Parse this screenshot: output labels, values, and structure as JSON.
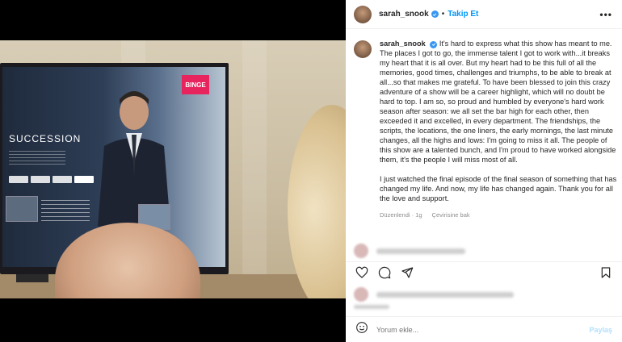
{
  "header": {
    "username": "sarah_snook",
    "separator": "•",
    "follow_label": "Takip Et",
    "more_label": "•••"
  },
  "media": {
    "tv": {
      "show_title": "SUCCESSION",
      "brand": "BINGE"
    }
  },
  "caption": {
    "username": "sarah_snook",
    "paragraph1": "It's hard to express what this show has meant to me. The places I got to go, the immense talent I got to work with...it breaks my heart that it is all over. But my heart had to be this full of all the memories, good times, challenges and triumphs, to be able to break at all...so that makes me grateful. To have been blessed to join this crazy adventure of a show will be a career highlight, which will no doubt be hard to top. I am so, so proud and humbled by everyone's hard work season after season: we all set the bar high for each other, then exceeded it and excelled, in every department. The friendships, the scripts, the locations, the one liners, the early mornings, the last minute changes, all the highs and lows: I'm going to miss it all. The people of this show are a talented bunch, and I'm proud to have worked alongside them, it's the people I will miss most of all.",
    "paragraph2": "I just watched the final episode of the final season of something that has changed my life. And now, my life has changed again. Thank you for all the love and support.",
    "edited_label": "Düzenlendi",
    "time_ago": "1g",
    "translate_label": "Çevirisine bak"
  },
  "comment_box": {
    "placeholder": "Yorum ekle...",
    "post_label": "Paylaş"
  },
  "colors": {
    "accent": "#0095f6",
    "verified": "#3897f0",
    "muted": "#8e8e8e"
  },
  "icons": [
    "verified-badge-icon",
    "heart-icon",
    "comment-icon",
    "share-icon",
    "bookmark-icon",
    "emoji-icon"
  ]
}
